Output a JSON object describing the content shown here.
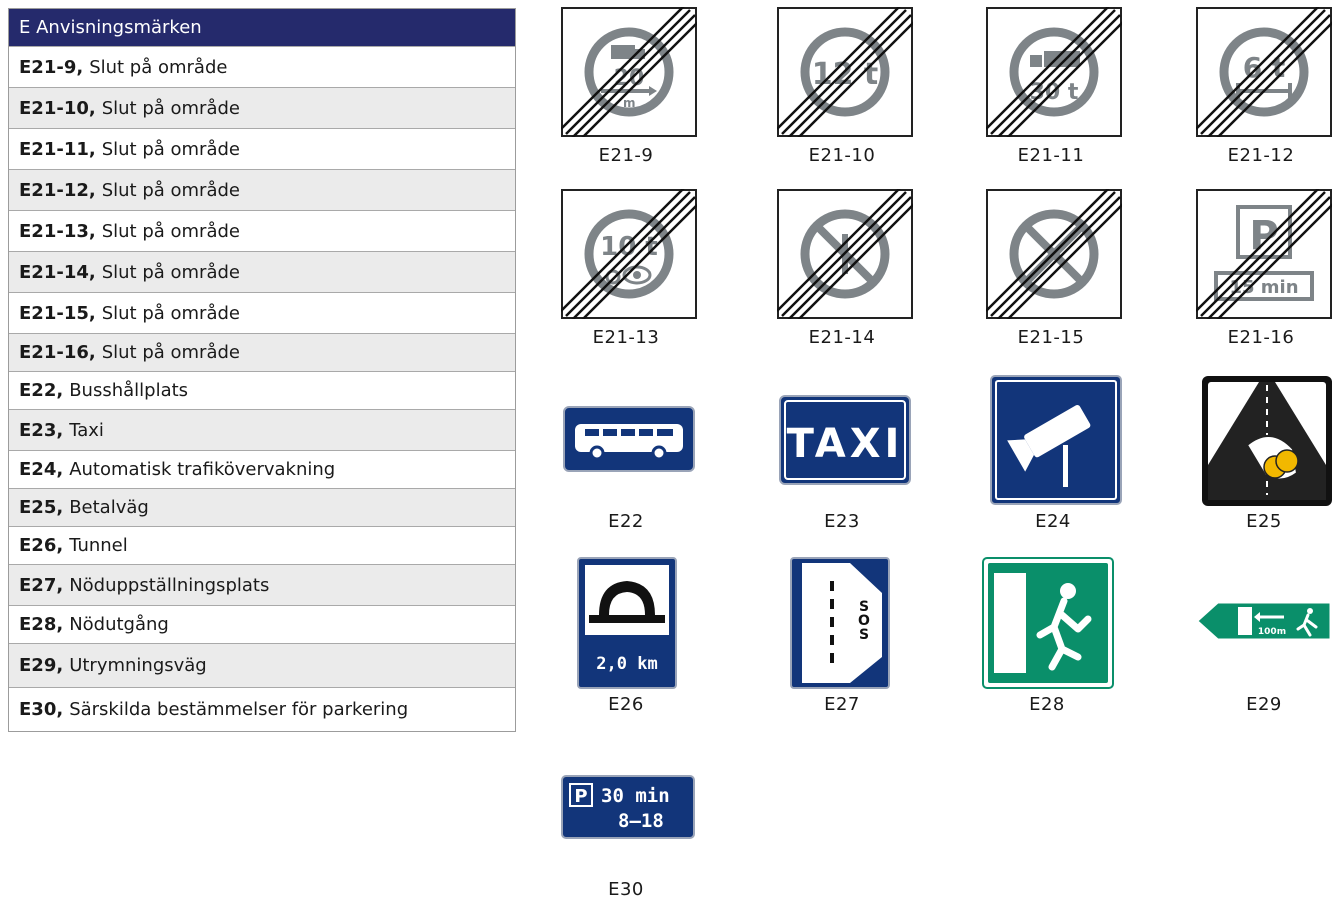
{
  "legend": {
    "title": "E Anvisningsmärken",
    "rows": [
      {
        "code": "E21-9,",
        "text": "Slut på område"
      },
      {
        "code": "E21-10,",
        "text": "Slut på område"
      },
      {
        "code": "E21-11,",
        "text": "Slut på område"
      },
      {
        "code": "E21-12,",
        "text": "Slut på område"
      },
      {
        "code": "E21-13,",
        "text": "Slut på område"
      },
      {
        "code": "E21-14,",
        "text": "Slut på område"
      },
      {
        "code": "E21-15,",
        "text": "Slut på område"
      },
      {
        "code": "E21-16,",
        "text": "Slut på område"
      },
      {
        "code": "E22,",
        "text": "Busshållplats"
      },
      {
        "code": "E23,",
        "text": "Taxi"
      },
      {
        "code": "E24,",
        "text": "Automatisk trafikövervakning"
      },
      {
        "code": "E25,",
        "text": "Betalväg"
      },
      {
        "code": "E26,",
        "text": "Tunnel"
      },
      {
        "code": "E27,",
        "text": "Nöduppställningsplats"
      },
      {
        "code": "E28,",
        "text": "Nödutgång"
      },
      {
        "code": "E29,",
        "text": "Utrymningsväg"
      },
      {
        "code": "E30,",
        "text": "Särskilda bestämmelser för parkering"
      }
    ]
  },
  "signs": {
    "e21_9": {
      "caption": "E21-9",
      "symbol_text": "20",
      "sub_text": "m"
    },
    "e21_10": {
      "caption": "E21-10",
      "symbol_text": "12 t"
    },
    "e21_11": {
      "caption": "E21-11",
      "symbol_text": "30 t"
    },
    "e21_12": {
      "caption": "E21-12",
      "symbol_text": "6 t"
    },
    "e21_13": {
      "caption": "E21-13",
      "symbol_text": "10 t"
    },
    "e21_14": {
      "caption": "E21-14"
    },
    "e21_15": {
      "caption": "E21-15"
    },
    "e21_16": {
      "caption": "E21-16",
      "symbol_text": "P",
      "sub_text": "15 min"
    },
    "e22": {
      "caption": "E22"
    },
    "e23": {
      "caption": "E23",
      "symbol_text": "TAXI"
    },
    "e24": {
      "caption": "E24"
    },
    "e25": {
      "caption": "E25"
    },
    "e26": {
      "caption": "E26",
      "symbol_text": "2,0 km"
    },
    "e27": {
      "caption": "E27",
      "symbol_text": "SOS"
    },
    "e28": {
      "caption": "E28"
    },
    "e29": {
      "caption": "E29",
      "symbol_text": "100m"
    },
    "e30": {
      "caption": "E30",
      "symbol_text": "P",
      "line1": "30 min",
      "line2": "8–18"
    }
  },
  "colors": {
    "header_bg": "#252a6c",
    "sign_blue": "#12357a",
    "sign_green": "#0a8f6a",
    "sign_grey": "#7e8488",
    "gold": "#f2b800"
  }
}
